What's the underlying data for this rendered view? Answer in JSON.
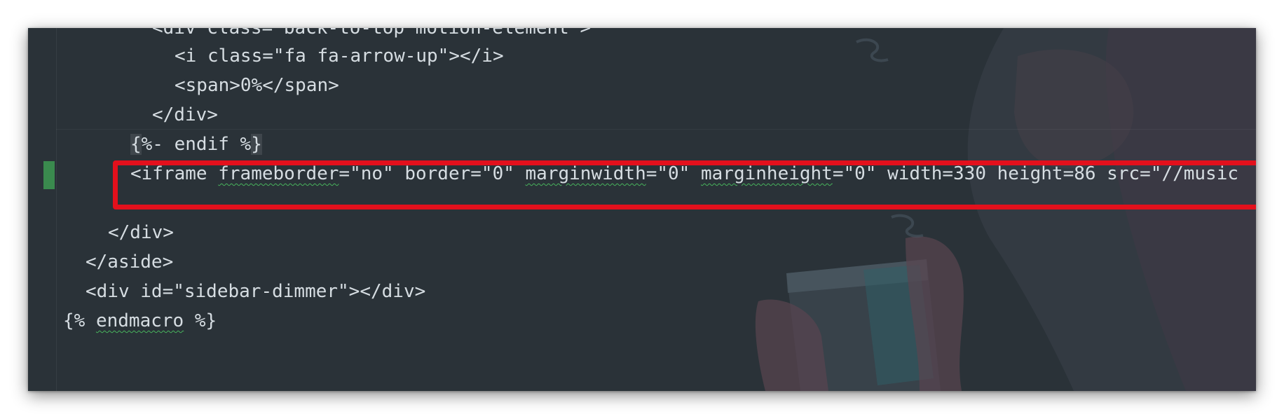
{
  "editor": {
    "lines": [
      "<div class=\"back-to-top motion-element\">",
      "<i class=\"fa fa-arrow-up\"></i>",
      "<span>0%</span>",
      "</div>",
      "%- endif %",
      "",
      "</div>",
      "</aside>",
      "<div id=\"sidebar-dimmer\"></div>",
      "{% endmacro %}"
    ],
    "brace_open": "{",
    "brace_close": "}",
    "iframe": {
      "p1": "<iframe ",
      "frameborder": "frameborder",
      "p2": "=\"no\" border=\"0\" ",
      "marginwidth": "marginwidth",
      "p3": "=\"0\" ",
      "marginheight": "marginheight",
      "p4": "=\"0\" width=330 height=86 src=\"//music"
    },
    "endmacro": {
      "pre": "{% ",
      "word": "endmacro",
      "post": " %}"
    }
  },
  "colors": {
    "background": "#2a3238",
    "text": "#d6dde2",
    "highlight_border": "#e3101c",
    "change_marker": "#3a8a4e"
  }
}
